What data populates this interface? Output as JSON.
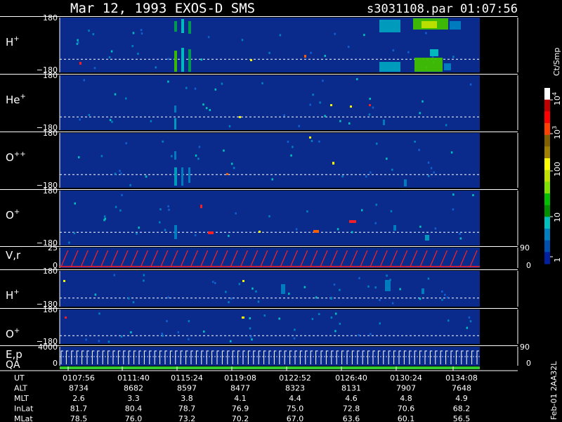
{
  "header": {
    "title": "Mar 12, 1993   EXOS-D SMS",
    "file": "s3031108.par  01:07:56"
  },
  "colors": {
    "background": "#000000",
    "panel_bg": "#0a2a8c",
    "dash": "#ffffff",
    "trace_red": "#ff2020",
    "qa_green": "#33cc33"
  },
  "chart_data": [
    {
      "type": "heatmap",
      "name": "panel-h-plus",
      "label": "H",
      "sup": "+",
      "ytop": "180",
      "ybottom": "−180",
      "ylim": [
        -180,
        180
      ]
    },
    {
      "type": "heatmap",
      "name": "panel-he-plus",
      "label": "He",
      "sup": "+",
      "ytop": "180",
      "ybottom": "−180",
      "ylim": [
        -180,
        180
      ]
    },
    {
      "type": "heatmap",
      "name": "panel-o-plus-plus",
      "label": "O",
      "sup": "++",
      "ytop": "180",
      "ybottom": "−180",
      "ylim": [
        -180,
        180
      ]
    },
    {
      "type": "heatmap",
      "name": "panel-o-plus",
      "label": "O",
      "sup": "+",
      "ytop": "180",
      "ybottom": "−180",
      "ylim": [
        -180,
        180
      ]
    },
    {
      "type": "line",
      "name": "panel-v-r",
      "label": "V,r",
      "ytop": "25",
      "ybottom": "0",
      "right_top": "90",
      "right_bottom": "0",
      "ylim": [
        0,
        25
      ]
    },
    {
      "type": "heatmap",
      "name": "panel-h-plus-2",
      "label": "H",
      "sup": "+",
      "ytop": "180",
      "ybottom": "−180",
      "ylim": [
        -180,
        180
      ]
    },
    {
      "type": "heatmap",
      "name": "panel-o-plus-2",
      "label": "O",
      "sup": "+",
      "ytop": "180",
      "ybottom": "−180",
      "ylim": [
        -180,
        180
      ]
    },
    {
      "type": "line",
      "name": "panel-e-p",
      "label": "E,p",
      "ytop": "4000",
      "ybottom": "0",
      "right_top": "90",
      "right_bottom": "0",
      "ylim": [
        0,
        4000
      ]
    }
  ],
  "qa_label": "QA",
  "colorbar": {
    "unit": "Ct/Smp",
    "ticks": [
      "10",
      "10",
      "100",
      "10",
      "1"
    ],
    "tick_sups": [
      "4",
      "3",
      "",
      "",
      ""
    ],
    "colors": [
      "#ffffff",
      "#c00000",
      "#ff0000",
      "#ff4000",
      "#806000",
      "#a08000",
      "#ffff00",
      "#c0e000",
      "#80e000",
      "#00c000",
      "#009000",
      "#00c0c0",
      "#0080c0",
      "#0050b0",
      "#0020a0"
    ]
  },
  "side_label": "Feb-01 2AA32L",
  "time_table": {
    "rows": [
      {
        "label": "UT",
        "values": [
          "0107:56",
          "0111:40",
          "0115:24",
          "0119:08",
          "0122:52",
          "0126:40",
          "0130:24",
          "0134:08"
        ]
      },
      {
        "label": "ALT",
        "values": [
          "8734",
          "8682",
          "8597",
          "8477",
          "8323",
          "8131",
          "7907",
          "7648"
        ]
      },
      {
        "label": "MLT",
        "values": [
          "2.6",
          "3.3",
          "3.8",
          "4.1",
          "4.4",
          "4.6",
          "4.8",
          "4.9"
        ]
      },
      {
        "label": "InLat",
        "values": [
          "81.7",
          "80.4",
          "78.7",
          "76.9",
          "75.0",
          "72.8",
          "70.6",
          "68.2"
        ]
      },
      {
        "label": "MLat",
        "values": [
          "78.5",
          "76.0",
          "73.2",
          "70.2",
          "67.0",
          "63.6",
          "60.1",
          "56.5"
        ]
      }
    ]
  }
}
